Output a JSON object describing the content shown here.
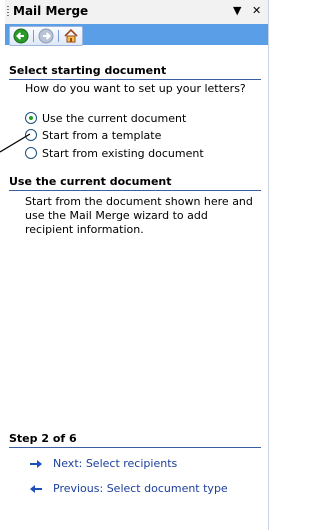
{
  "pane": {
    "title": "Mail Merge",
    "dropdown_icon": "▼",
    "close_icon": "✕"
  },
  "nav": {
    "back": "back-icon",
    "forward": "forward-icon",
    "home": "home-icon"
  },
  "section1": {
    "heading": "Select starting document",
    "question": "How do you want to set up your letters?",
    "options": [
      {
        "label": "Use the current document",
        "selected": true
      },
      {
        "label": "Start from a template",
        "selected": false
      },
      {
        "label": "Start from existing document",
        "selected": false
      }
    ]
  },
  "section2": {
    "heading": "Use the current document",
    "description": "Start from the document shown here and use the Mail Merge wizard to add recipient information."
  },
  "step": {
    "label": "Step 2 of 6",
    "next": "Next: Select recipients",
    "previous": "Previous: Select document type"
  }
}
